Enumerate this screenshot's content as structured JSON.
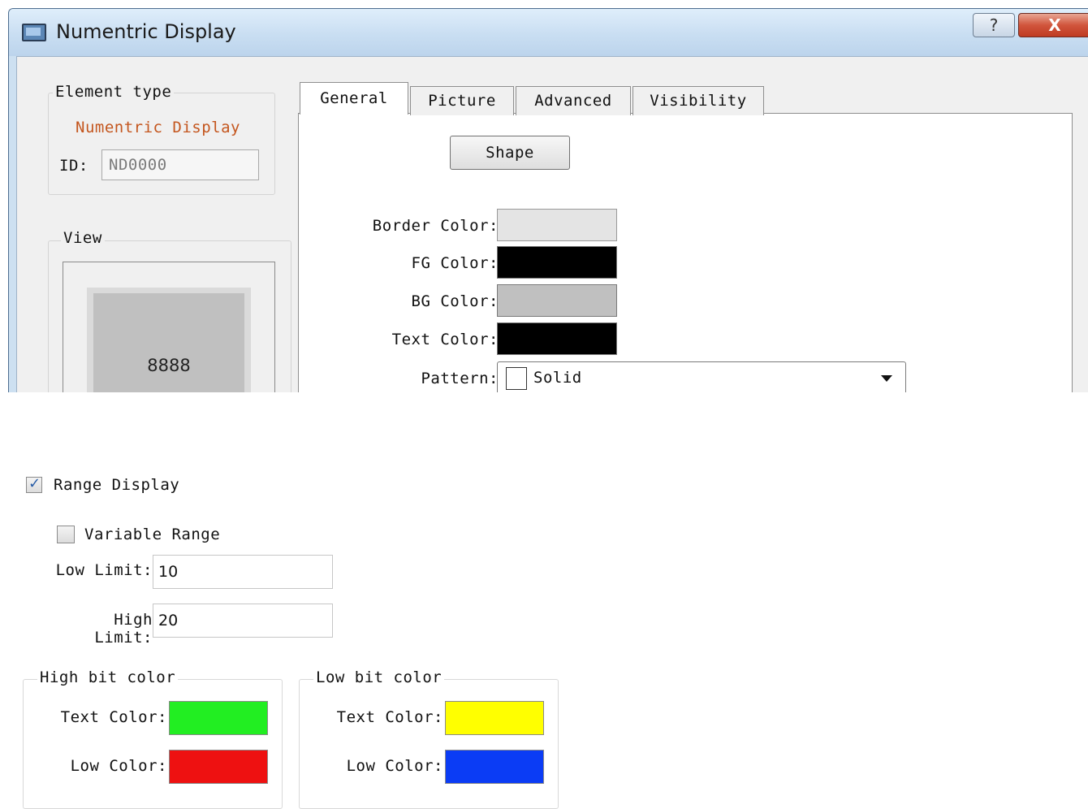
{
  "window": {
    "title": "Numentric Display",
    "help_label": "?",
    "close_label": "X"
  },
  "element_type": {
    "legend": "Element type",
    "value": "Numentric Display",
    "id_label": "ID:",
    "id_value": "ND0000"
  },
  "view": {
    "legend": "View",
    "preview_text": "8888"
  },
  "tabs": [
    {
      "label": "General",
      "active": true
    },
    {
      "label": "Picture",
      "active": false
    },
    {
      "label": "Advanced",
      "active": false
    },
    {
      "label": "Visibility",
      "active": false
    }
  ],
  "general": {
    "shape_button": "Shape",
    "border_color": {
      "label": "Border Color:",
      "color": "#e4e4e4"
    },
    "fg_color": {
      "label": "FG Color:",
      "color": "#000000"
    },
    "bg_color": {
      "label": "BG Color:",
      "color": "#c0c0c0"
    },
    "text_color": {
      "label": "Text Color:",
      "color": "#000000"
    },
    "pattern": {
      "label": "Pattern:",
      "value": "Solid"
    }
  },
  "range": {
    "range_display": {
      "label": "Range Display",
      "checked": true
    },
    "variable_range": {
      "label": "Variable Range",
      "checked": false
    },
    "low_limit": {
      "label": "Low Limit:",
      "value": "10"
    },
    "high_limit": {
      "label": "High Limit:",
      "value": "20"
    }
  },
  "high_bit_color": {
    "legend": "High bit color",
    "text_color": {
      "label": "Text Color:",
      "color": "#22ee22"
    },
    "low_color": {
      "label": "Low Color:",
      "color": "#ee1111"
    }
  },
  "low_bit_color": {
    "legend": "Low bit color",
    "text_color": {
      "label": "Text Color:",
      "color": "#ffff00"
    },
    "low_color": {
      "label": "Low Color:",
      "color": "#0b3cf5"
    }
  }
}
